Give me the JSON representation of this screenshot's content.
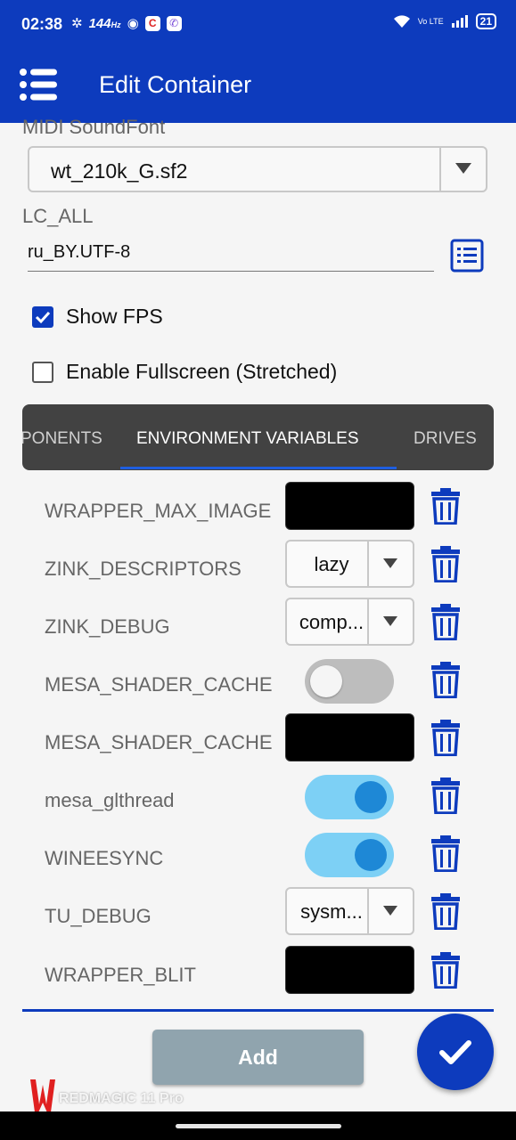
{
  "status_bar": {
    "time": "02:38",
    "refresh_rate": "144",
    "refresh_unit": "Hz",
    "network": "Vo LTE",
    "battery": "21"
  },
  "app_bar": {
    "title": "Edit Container",
    "menu_icon": "hamburger-menu-icon"
  },
  "midi": {
    "label": "MIDI SoundFont",
    "value": "wt_210k_G.sf2"
  },
  "lc_all": {
    "label": "LC_ALL",
    "value": "ru_BY.UTF-8"
  },
  "checkboxes": [
    {
      "label": "Show FPS",
      "checked": true
    },
    {
      "label": "Enable Fullscreen (Stretched)",
      "checked": false
    }
  ],
  "tabs": [
    {
      "label": "PONENTS",
      "active": false
    },
    {
      "label": "ENVIRONMENT VARIABLES",
      "active": true
    },
    {
      "label": "DRIVES",
      "active": false
    }
  ],
  "env_vars": [
    {
      "name": "WRAPPER_MAX_IMAGE",
      "control": "text",
      "value": ""
    },
    {
      "name": "ZINK_DESCRIPTORS",
      "control": "select",
      "value": "lazy"
    },
    {
      "name": "ZINK_DEBUG",
      "control": "select",
      "value": "comp..."
    },
    {
      "name": "MESA_SHADER_CACHE",
      "control": "toggle",
      "value": false
    },
    {
      "name": "MESA_SHADER_CACHE",
      "control": "text",
      "value": ""
    },
    {
      "name": "mesa_glthread",
      "control": "toggle",
      "value": true
    },
    {
      "name": "WINEESYNC",
      "control": "toggle",
      "value": true
    },
    {
      "name": "TU_DEBUG",
      "control": "select",
      "value": "sysm..."
    },
    {
      "name": "WRAPPER_BLIT",
      "control": "text",
      "value": ""
    }
  ],
  "add_button": "Add",
  "fab_icon": "checkmark-icon",
  "watermark": "REDMAGIC 11 Pro",
  "colors": {
    "primary": "#0d3bbd",
    "toggle_on_track": "#7dd0f5",
    "toggle_on_knob": "#1e88d6",
    "tab_bar": "#424242",
    "add_button": "#90a4ae"
  }
}
